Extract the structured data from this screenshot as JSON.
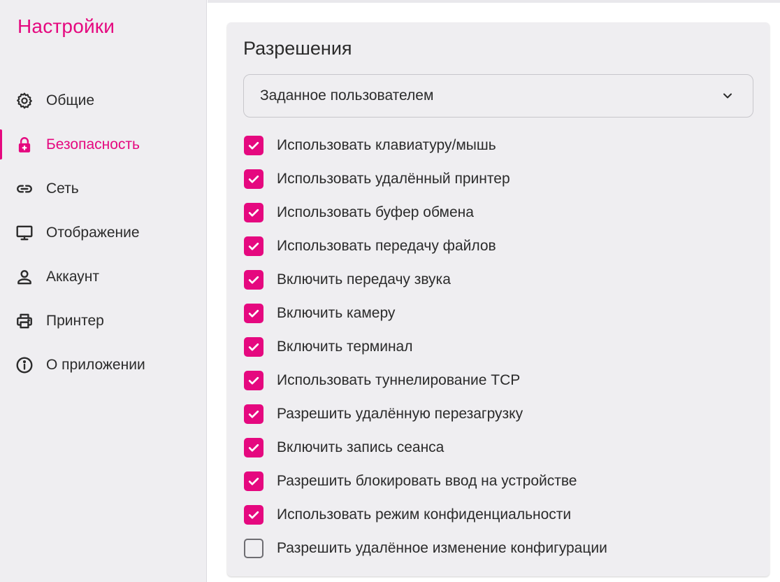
{
  "sidebar": {
    "title": "Настройки",
    "items": [
      {
        "label": "Общие",
        "icon": "gear-icon",
        "active": false
      },
      {
        "label": "Безопасность",
        "icon": "lock-icon",
        "active": true
      },
      {
        "label": "Сеть",
        "icon": "link-icon",
        "active": false
      },
      {
        "label": "Отображение",
        "icon": "monitor-icon",
        "active": false
      },
      {
        "label": "Аккаунт",
        "icon": "person-icon",
        "active": false
      },
      {
        "label": "Принтер",
        "icon": "printer-icon",
        "active": false
      },
      {
        "label": "О приложении",
        "icon": "info-icon",
        "active": false
      }
    ]
  },
  "permissions": {
    "title": "Разрешения",
    "preset_select": {
      "value": "Заданное пользователем"
    },
    "options": [
      {
        "label": "Использовать клавиатуру/мышь",
        "checked": true
      },
      {
        "label": "Использовать удалённый принтер",
        "checked": true
      },
      {
        "label": "Использовать буфер обмена",
        "checked": true
      },
      {
        "label": "Использовать передачу файлов",
        "checked": true
      },
      {
        "label": "Включить передачу звука",
        "checked": true
      },
      {
        "label": "Включить камеру",
        "checked": true
      },
      {
        "label": "Включить терминал",
        "checked": true
      },
      {
        "label": "Использовать туннелирование TCP",
        "checked": true
      },
      {
        "label": "Разрешить удалённую перезагрузку",
        "checked": true
      },
      {
        "label": "Включить запись сеанса",
        "checked": true
      },
      {
        "label": "Разрешить блокировать ввод на устройстве",
        "checked": true
      },
      {
        "label": "Использовать режим конфиденциальности",
        "checked": true
      },
      {
        "label": "Разрешить удалённое изменение конфигурации",
        "checked": false
      }
    ]
  },
  "colors": {
    "accent": "#e5087f",
    "sidebar_bg": "#efeef1",
    "text": "#2b2b2b"
  }
}
